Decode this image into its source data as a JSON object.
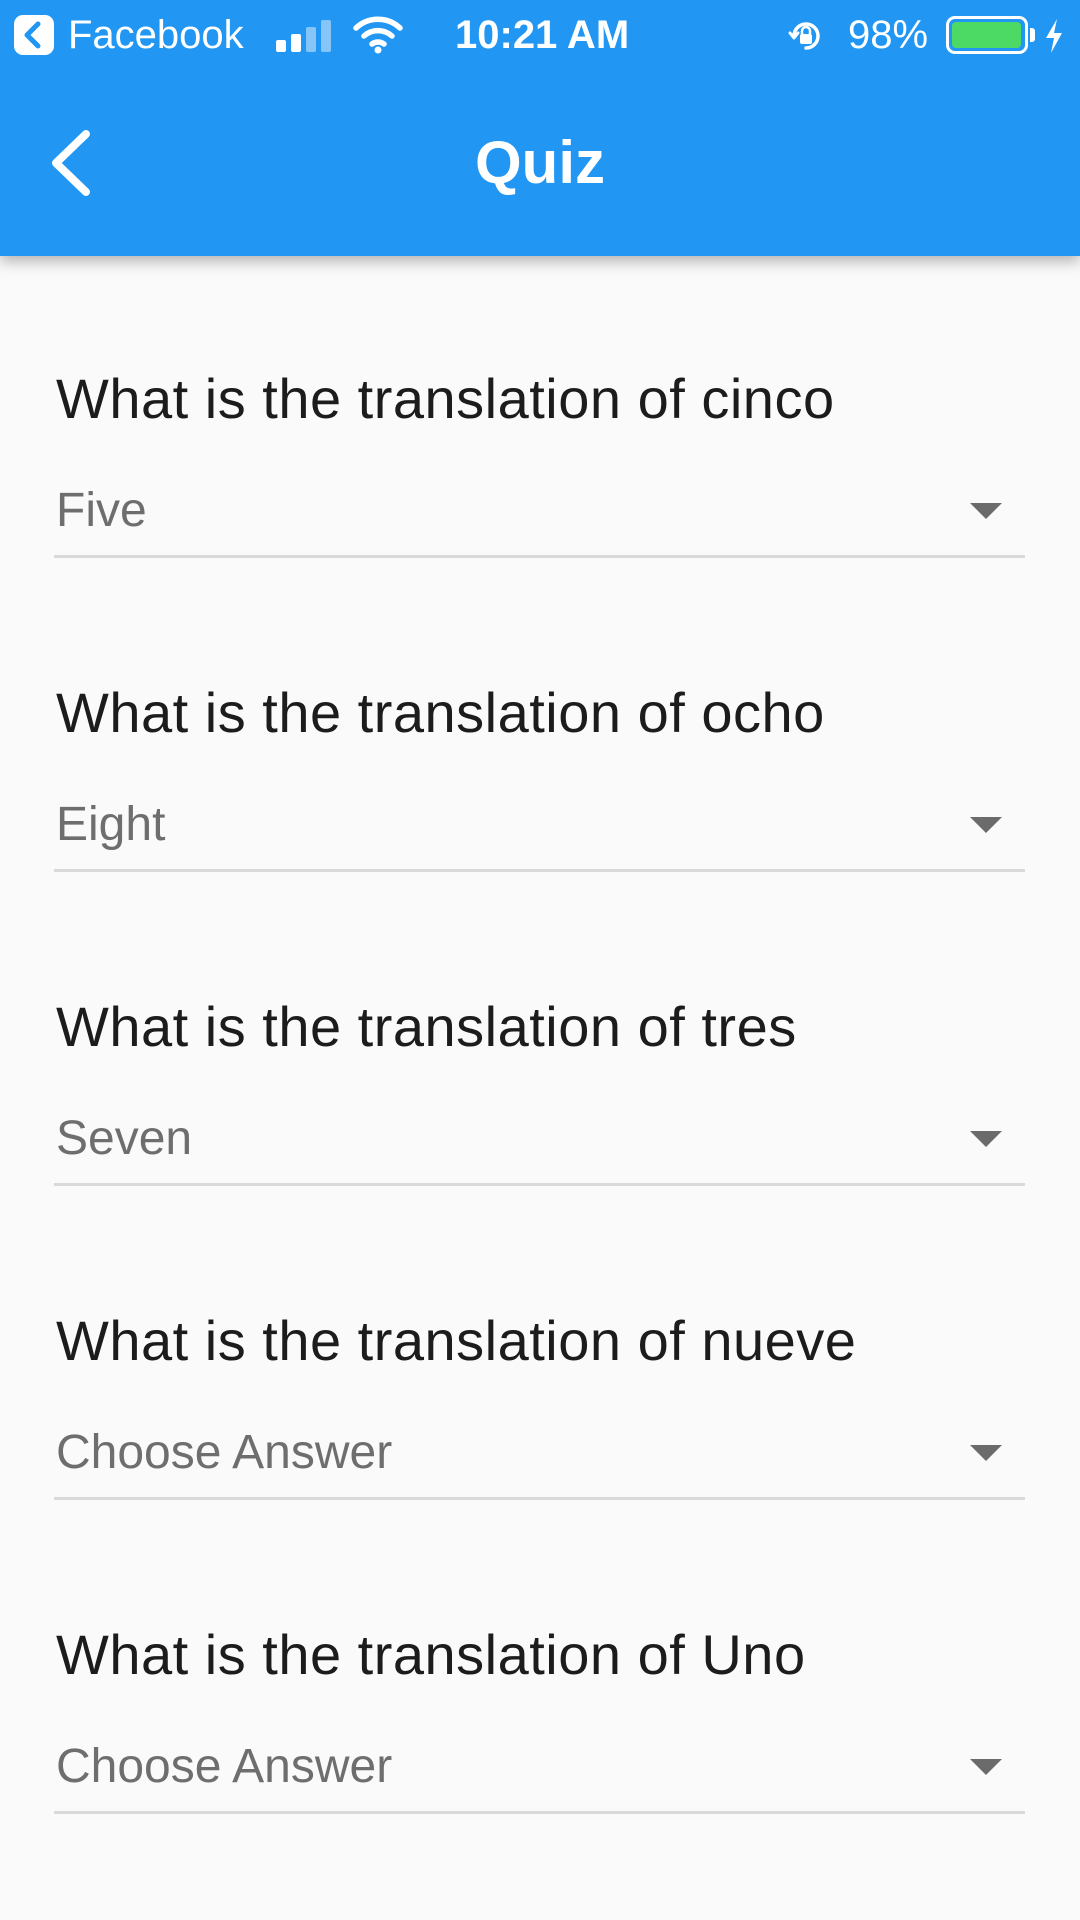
{
  "status_bar": {
    "back_app": "Facebook",
    "time": "10:21 AM",
    "battery_percent": "98%",
    "battery_level": 0.98,
    "signal_bars_filled": 2,
    "signal_bars_total": 4,
    "battery_color": "#4cd964",
    "icons": [
      "back-to-app-icon",
      "cellular-signal-icon",
      "wifi-icon",
      "orientation-lock-icon",
      "battery-icon",
      "charging-bolt-icon"
    ]
  },
  "app_bar": {
    "title": "Quiz",
    "back_icon": "chevron-left-icon",
    "background": "#2196f3"
  },
  "questions": [
    {
      "prompt": "What is the translation of cinco",
      "answer": "Five"
    },
    {
      "prompt": "What is the translation of ocho",
      "answer": "Eight"
    },
    {
      "prompt": "What is the translation of tres",
      "answer": "Seven"
    },
    {
      "prompt": "What is the translation of nueve",
      "answer": "Choose Answer"
    },
    {
      "prompt": "What is the translation of Uno",
      "answer": "Choose Answer"
    }
  ]
}
